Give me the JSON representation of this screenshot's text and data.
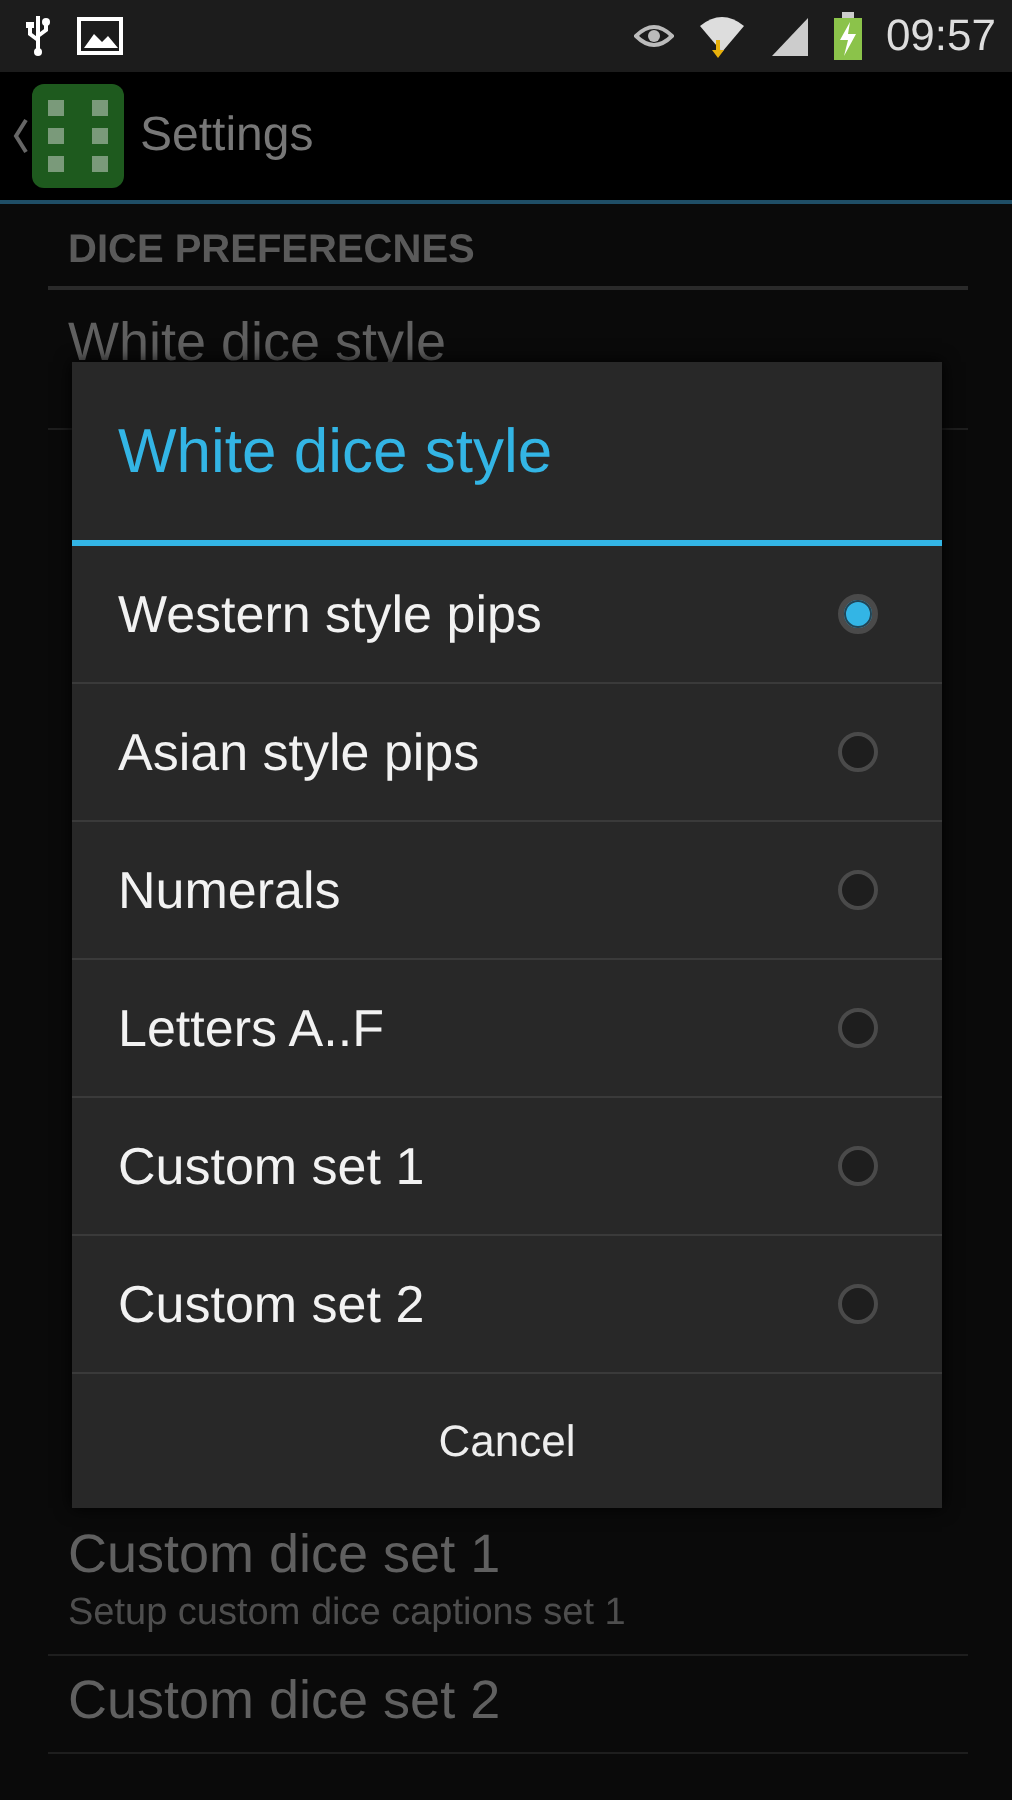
{
  "status_bar": {
    "time": "09:57"
  },
  "action_bar": {
    "title": "Settings"
  },
  "settings": {
    "section": "DICE PREFERECNES",
    "items_above": [
      {
        "title": "White dice style"
      }
    ],
    "items_below": [
      {
        "title": "Custom dice set 1",
        "summary": "Setup custom dice captions set 1"
      },
      {
        "title": "Custom dice set 2"
      }
    ]
  },
  "dialog": {
    "title": "White dice style",
    "options": [
      {
        "label": "Western style pips",
        "selected": true
      },
      {
        "label": "Asian style pips",
        "selected": false
      },
      {
        "label": "Numerals",
        "selected": false
      },
      {
        "label": "Letters A..F",
        "selected": false
      },
      {
        "label": "Custom set 1",
        "selected": false
      },
      {
        "label": "Custom set 2",
        "selected": false
      }
    ],
    "cancel": "Cancel"
  }
}
